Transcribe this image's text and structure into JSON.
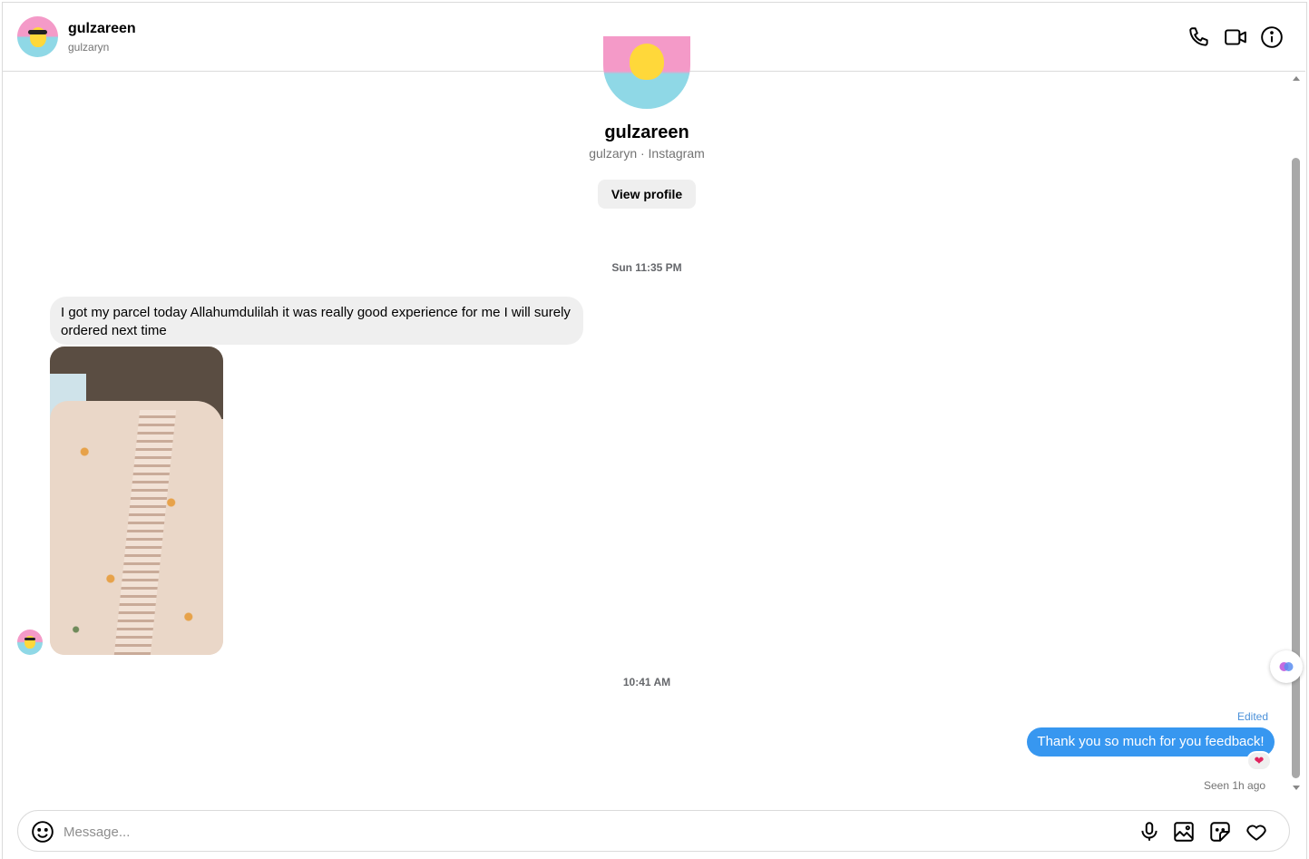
{
  "header": {
    "name": "gulzareen",
    "username": "gulzaryn",
    "icons": [
      "phone-icon",
      "video-call-icon",
      "info-icon"
    ]
  },
  "profile": {
    "name": "gulzareen",
    "subtitle": "gulzaryn · Instagram",
    "view_profile_label": "View profile"
  },
  "messages": {
    "timestamp_1": "Sun 11:35 PM",
    "incoming_text": "I got my parcel today Allahumdulilah it was really good experience for me I will surely ordered next time",
    "timestamp_2": "10:41 AM",
    "edited_label": "Edited",
    "outgoing_text": "Thank you so much for you feedback!",
    "reaction": "❤",
    "seen_label": "Seen 1h ago"
  },
  "composer": {
    "placeholder": "Message...",
    "value": ""
  },
  "colors": {
    "accent": "#3797f0",
    "bubble_in": "#efefef",
    "muted": "#737373"
  }
}
